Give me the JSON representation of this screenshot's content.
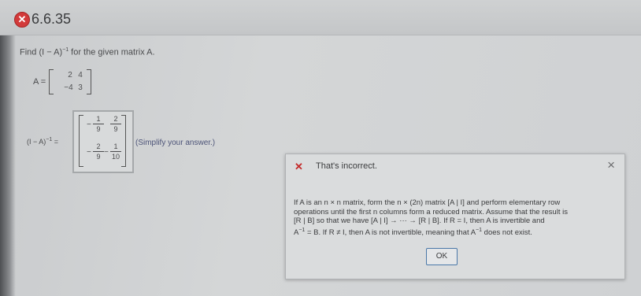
{
  "header": {
    "status_icon": "x-circle-icon",
    "question_number": "6.6.35"
  },
  "problem": {
    "prefix": "Find (I − A)",
    "exponent": "−1",
    "suffix": " for the given matrix A."
  },
  "matrix_a": {
    "label": "A =",
    "rows": [
      [
        "2",
        "4"
      ],
      [
        "−4",
        "3"
      ]
    ]
  },
  "answer": {
    "label_prefix": "(I − A)",
    "label_exponent": "−1",
    "label_suffix": " =",
    "cells": [
      {
        "sign": "−",
        "num": "1",
        "den": "9"
      },
      {
        "sign": "",
        "num": "2",
        "den": "9"
      },
      {
        "sign": "−",
        "num": "2",
        "den": "9"
      },
      {
        "sign": "−",
        "num": "1",
        "den": "10"
      }
    ],
    "hint": "(Simplify your answer.)"
  },
  "feedback": {
    "title": "That's incorrect.",
    "close_symbol": "×",
    "message_line1": "If A is an n × n matrix, form the n × (2n) matrix [A | I] and perform elementary row",
    "message_line2": "operations until the first n columns form a reduced matrix. Assume that the result is",
    "message_line3": "[R | B] so that we have [A | I] → ··· → [R | B]. If R = I, then A is invertible and",
    "message_line4a": "A",
    "message_line4_exp": "−1",
    "message_line4b": " = B. If R ≠ I, then A is not invertible, meaning that A",
    "message_line4_exp2": "−1",
    "message_line4c": " does not exist.",
    "ok_label": "OK"
  }
}
